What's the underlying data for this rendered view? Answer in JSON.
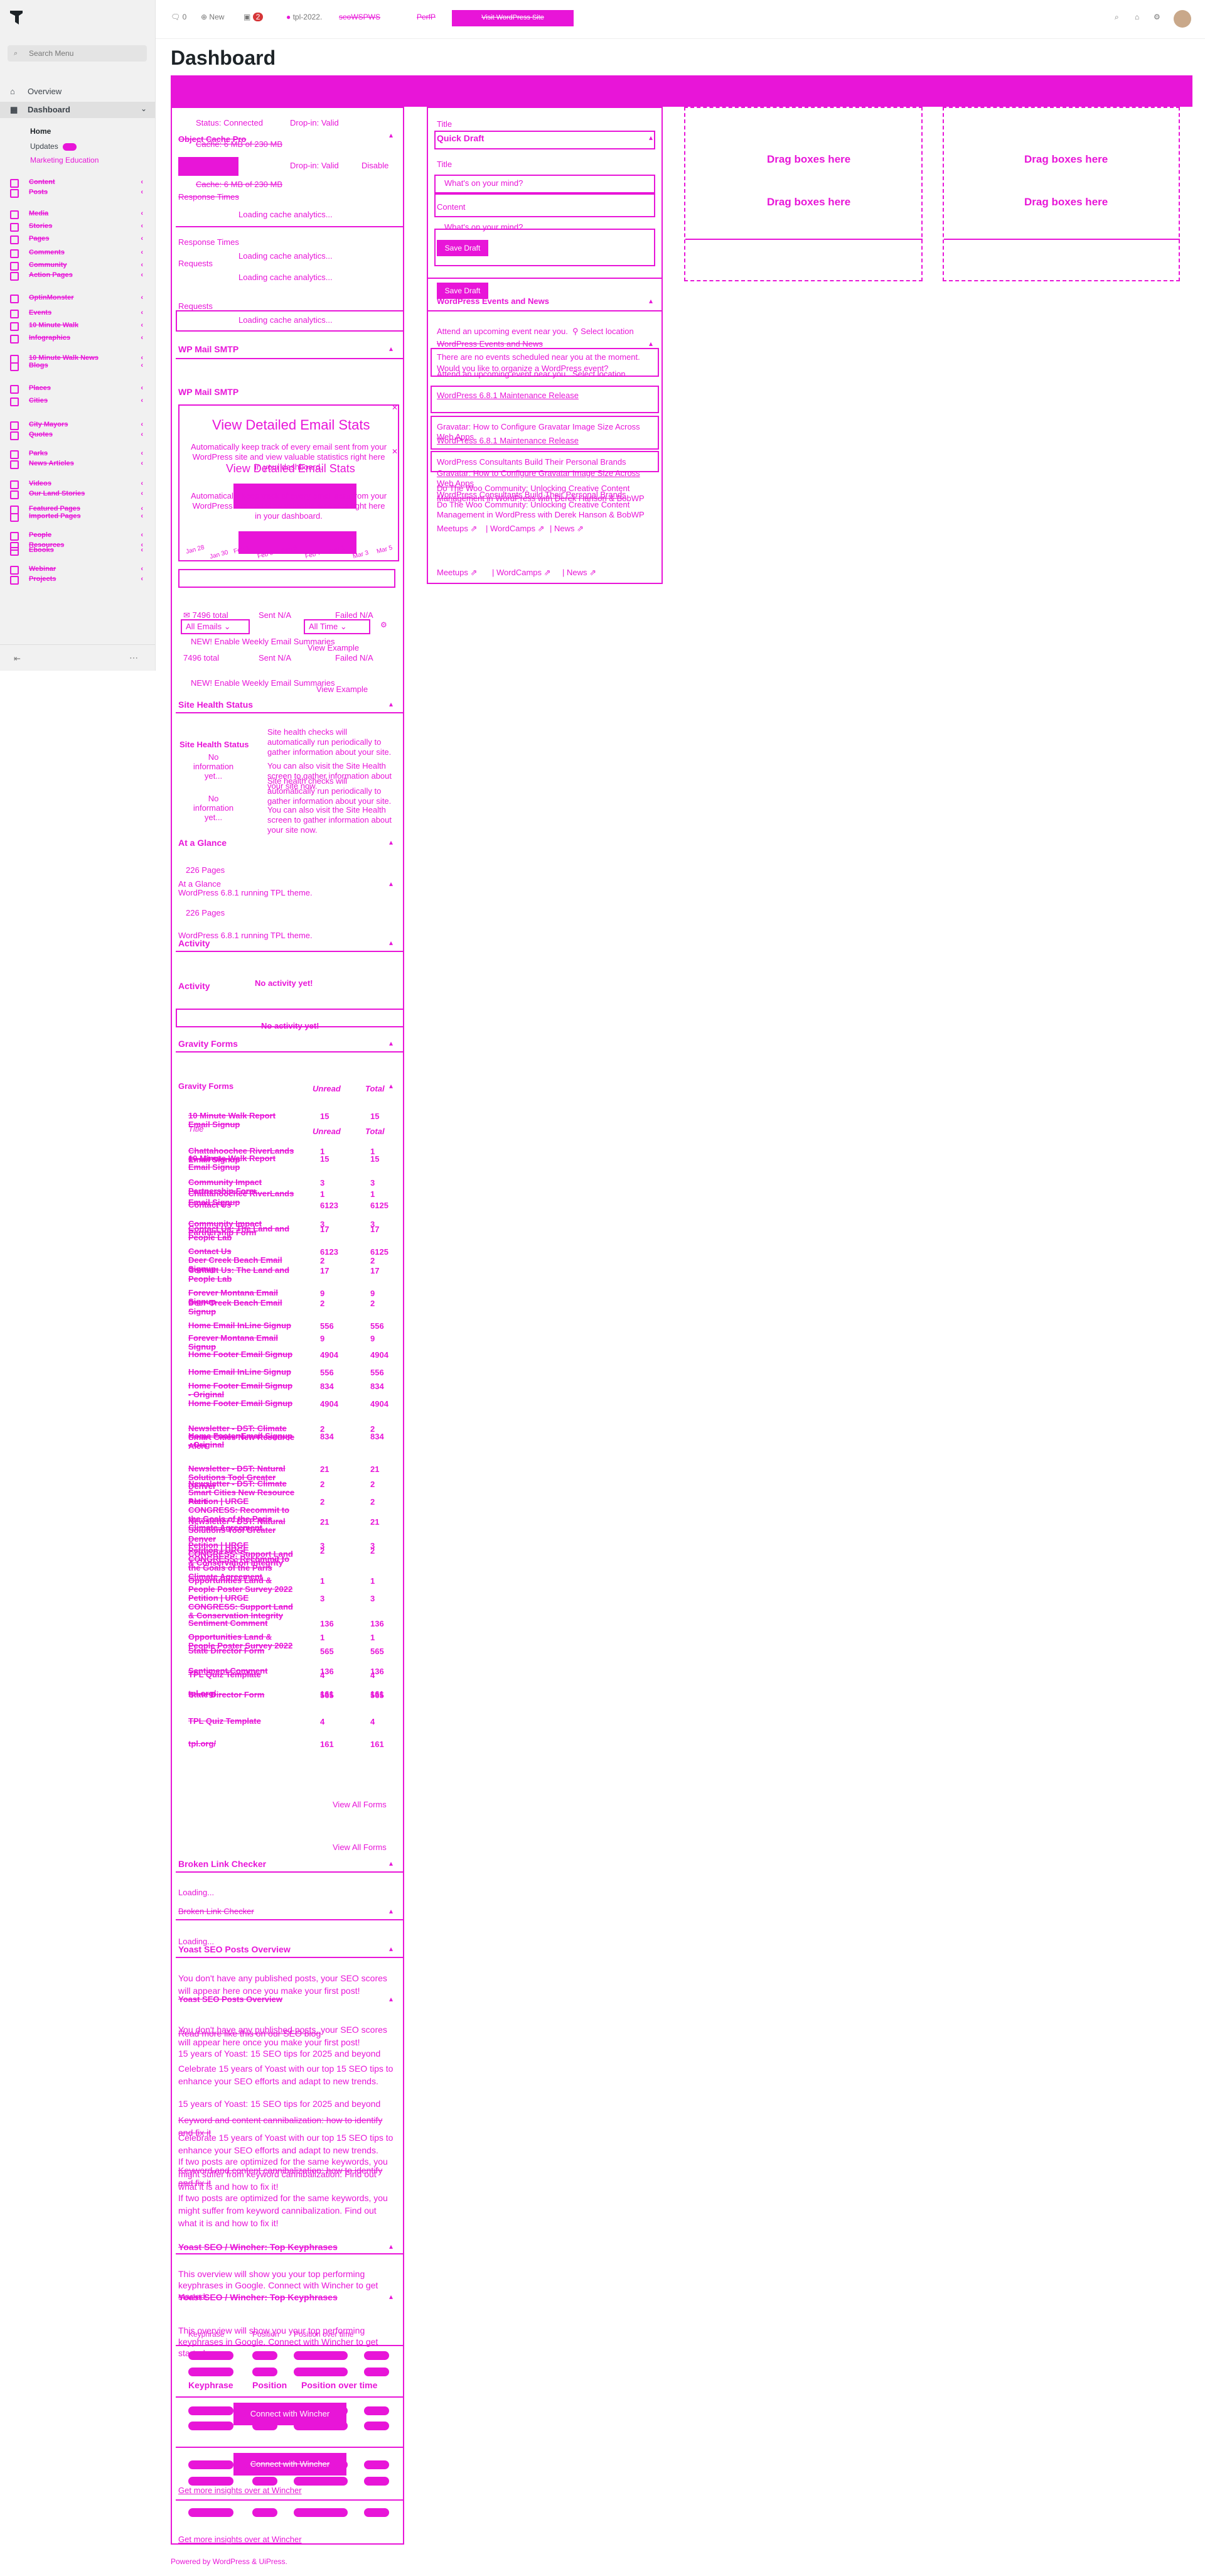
{
  "topbar": {
    "comments": "0",
    "new_label": "New",
    "updates": "2",
    "site_url": "tpl-2022.",
    "seo_label": "seoWSPWS",
    "visit_label": "Visit WordPress Site",
    "plugin_label": "PerfP"
  },
  "sidebar": {
    "search_placeholder": "Search Menu",
    "overview": "Overview",
    "dashboard": "Dashboard",
    "sub_home": "Home",
    "sub_marketing": "Marketing Education",
    "sub_updates": "Updates",
    "menu": [
      "Content",
      "Posts",
      "Media",
      "Stories",
      "Pages",
      "Comments",
      "Community",
      "Action Pages",
      "OptinMonster",
      "Events",
      "10 Minute Walk",
      "Infographics",
      "10 Minute Walk News",
      "Blogs",
      "Places",
      "Cities",
      "City Mayors",
      "Quotes",
      "Parks",
      "News Articles",
      "Videos",
      "Our Land Stories",
      "Featured Pages",
      "Imported Pages",
      "People",
      "Resources",
      "Ebooks",
      "Webinar",
      "Projects"
    ]
  },
  "page": {
    "title": "Dashboard"
  },
  "cache": {
    "status_connected": "Status: Connected",
    "drop_in": "Drop-in: Valid",
    "cache_size": "Object Cache Pro",
    "cache_mb": "Cache: 6 MB of 230 MB",
    "disable": "Disable",
    "response_times": "Response Times",
    "loading_analytics": "Loading cache analytics...",
    "requests": "Requests"
  },
  "smtp": {
    "title": "WP Mail SMTP",
    "email_stats_title": "View Detailed Email Stats",
    "email_stats_text": "Automatically keep track of every email sent from your WordPress site and view valuable statistics right here in your dashboard.",
    "total": "7496 total",
    "sent": "Sent N/A",
    "failed": "Failed N/A",
    "all_emails": "All Emails",
    "all_time": "All Time",
    "weekly": "NEW! Enable Weekly Email Summaries",
    "view_example": "View Example",
    "axis": [
      "Jan 28",
      "Jan 30",
      "Feb 1",
      "Feb 3",
      "Feb 5",
      "Feb 7",
      "Mar 1",
      "Mar 3",
      "Mar 5"
    ]
  },
  "site_health": {
    "title": "Site Health Status",
    "no_info": "No information yet...",
    "text1": "Site health checks will automatically run periodically to gather information about your site.",
    "text2": "You can also visit the Site Health screen to gather information about your site now."
  },
  "glance": {
    "title": "At a Glance",
    "pages": "226 Pages",
    "running": "WordPress 6.8.1 running TPL theme."
  },
  "activity": {
    "title": "Activity",
    "empty": "No activity yet!"
  },
  "gravity": {
    "title": "Gravity Forms",
    "col_title": "Title",
    "col_unread": "Unread",
    "col_total": "Total",
    "view_all": "View All Forms",
    "rows": [
      {
        "name": "10 Minute Walk Report Email Signup",
        "unread": "15",
        "total": "15"
      },
      {
        "name": "Chattahoochee RiverLands Email Signup",
        "unread": "1",
        "total": "1"
      },
      {
        "name": "Community Impact Partnership Form",
        "unread": "3",
        "total": "3"
      },
      {
        "name": "Contact Us",
        "unread": "6123",
        "total": "6125"
      },
      {
        "name": "Contact Us: The Land and People Lab",
        "unread": "17",
        "total": "17"
      },
      {
        "name": "Deer Creek Beach Email Signup",
        "unread": "2",
        "total": "2"
      },
      {
        "name": "Forever Montana Email Signup",
        "unread": "9",
        "total": "9"
      },
      {
        "name": "Home Email InLine Signup",
        "unread": "556",
        "total": "556"
      },
      {
        "name": "Home Footer Email Signup",
        "unread": "4904",
        "total": "4904"
      },
      {
        "name": "Home Footer Email Signup - Original",
        "unread": "834",
        "total": "834"
      },
      {
        "name": "Newsletter - DST: Climate Smart Cities New Resource Alert",
        "unread": "2",
        "total": "2"
      },
      {
        "name": "Newsletter - DST: Natural Solutions Tool Greater Denver",
        "unread": "21",
        "total": "21"
      },
      {
        "name": "Petition | URGE CONGRESS: Recommit to the Goals of the Paris Climate Agreement",
        "unread": "2",
        "total": "2"
      },
      {
        "name": "Petition | URGE CONGRESS: Support Land & Conservation Integrity",
        "unread": "3",
        "total": "3"
      },
      {
        "name": "Opportunities Land & People Poster Survey 2022",
        "unread": "1",
        "total": "1"
      },
      {
        "name": "Sentiment Comment",
        "unread": "136",
        "total": "136"
      },
      {
        "name": "State Director Form",
        "unread": "565",
        "total": "565"
      },
      {
        "name": "TPL Quiz Template",
        "unread": "4",
        "total": "4"
      },
      {
        "name": "tpl.org/",
        "unread": "161",
        "total": "161"
      }
    ]
  },
  "blc": {
    "title": "Broken Link Checker",
    "loading": "Loading..."
  },
  "yoast": {
    "title": "Yoast SEO Posts Overview",
    "text": "You don't have any published posts, your SEO scores will appear here once you make your first post!",
    "latest": "Read more like this on our SEO blog",
    "news1": "15 years of Yoast: 15 SEO tips for 2025 and beyond",
    "news2": "Celebrate 15 years of Yoast with our top 15 SEO tips to enhance your SEO efforts and adapt to new trends.",
    "news3": "Keyword and content cannibalization: how to identify and fix it",
    "news4": "If two posts are optimized for the same keywords, you might suffer from keyword cannibalization. Find out what it is and how to fix it!"
  },
  "wincher": {
    "title": "Yoast SEO / Wincher: Top Keyphrases",
    "text": "This overview will show you your top performing keyphrases in Google. Connect with Wincher to get started.",
    "col1": "Keyphrase",
    "col2": "Position",
    "col3": "Position over time",
    "connect": "Connect with Wincher",
    "more": "Get more insights over at Wincher"
  },
  "quick_draft": {
    "title": "Quick Draft",
    "label_title": "Title",
    "label_content": "Content",
    "placeholder": "What's on your mind?",
    "save": "Save Draft"
  },
  "events": {
    "title": "WordPress Events and News",
    "attend": "Attend an upcoming event near you.",
    "select": "Select location",
    "none": "There are no events scheduled near you at the moment. Would you like to organize a WordPress event?",
    "news": [
      "WordPress 6.8.1 Maintenance Release",
      "Gravatar: How to Configure Gravatar Image Size Across Web Apps",
      "WordPress Consultants Build Their Personal Brands",
      "Do The Woo Community: Unlocking Creative Content Management in WordPress with Derek Hanson & BobWP"
    ],
    "meetups": "Meetups",
    "wordcamps": "WordCamps",
    "news_link": "News"
  },
  "drag": {
    "label": "Drag boxes here"
  },
  "footer": {
    "powered": "Powered by WordPress & UiPress."
  }
}
